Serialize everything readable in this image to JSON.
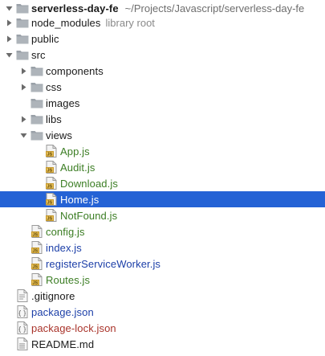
{
  "project": {
    "name": "serverless-day-fe",
    "path": "~/Projects/Javascript/serverless-day-fe"
  },
  "tree": [
    {
      "label": "node_modules",
      "note": "library root",
      "type": "folder",
      "indent": 0,
      "expanded": false,
      "color": "default",
      "slug": "node-modules"
    },
    {
      "label": "public",
      "type": "folder",
      "indent": 0,
      "expanded": false,
      "color": "default",
      "slug": "public"
    },
    {
      "label": "src",
      "type": "folder",
      "indent": 0,
      "expanded": true,
      "color": "default",
      "slug": "src"
    },
    {
      "label": "components",
      "type": "folder",
      "indent": 1,
      "expanded": false,
      "color": "default",
      "slug": "components"
    },
    {
      "label": "css",
      "type": "folder",
      "indent": 1,
      "expanded": false,
      "color": "default",
      "slug": "css"
    },
    {
      "label": "images",
      "type": "folder",
      "indent": 1,
      "expanded": null,
      "color": "default",
      "slug": "images"
    },
    {
      "label": "libs",
      "type": "folder",
      "indent": 1,
      "expanded": false,
      "color": "default",
      "slug": "libs"
    },
    {
      "label": "views",
      "type": "folder",
      "indent": 1,
      "expanded": true,
      "color": "default",
      "slug": "views"
    },
    {
      "label": "App.js",
      "type": "js",
      "indent": 2,
      "color": "green",
      "slug": "app-js"
    },
    {
      "label": "Audit.js",
      "type": "js",
      "indent": 2,
      "color": "green",
      "slug": "audit-js"
    },
    {
      "label": "Download.js",
      "type": "js",
      "indent": 2,
      "color": "green",
      "slug": "download-js"
    },
    {
      "label": "Home.js",
      "type": "js",
      "indent": 2,
      "color": "default",
      "selected": true,
      "slug": "home-js"
    },
    {
      "label": "NotFound.js",
      "type": "js",
      "indent": 2,
      "color": "green",
      "slug": "notfound-js"
    },
    {
      "label": "config.js",
      "type": "js",
      "indent": 1,
      "color": "green",
      "slug": "config-js"
    },
    {
      "label": "index.js",
      "type": "js",
      "indent": 1,
      "color": "blue",
      "slug": "index-js"
    },
    {
      "label": "registerServiceWorker.js",
      "type": "js",
      "indent": 1,
      "color": "blue",
      "slug": "registerserviceworker-js"
    },
    {
      "label": "Routes.js",
      "type": "js",
      "indent": 1,
      "color": "green",
      "slug": "routes-js"
    },
    {
      "label": ".gitignore",
      "type": "text",
      "indent": 0,
      "color": "default",
      "slug": "gitignore"
    },
    {
      "label": "package.json",
      "type": "json",
      "indent": 0,
      "color": "blue",
      "slug": "package-json"
    },
    {
      "label": "package-lock.json",
      "type": "json",
      "indent": 0,
      "color": "red",
      "slug": "package-lock-json"
    },
    {
      "label": "README.md",
      "type": "md",
      "indent": 0,
      "color": "default",
      "slug": "readme-md"
    }
  ],
  "colors": {
    "selection": "#2462d5",
    "folder": "#9aa1a8",
    "js_icon": "#e8c05a",
    "green_text": "#3b7d23",
    "blue_text": "#1c3fa8",
    "red_text": "#a9332a"
  }
}
